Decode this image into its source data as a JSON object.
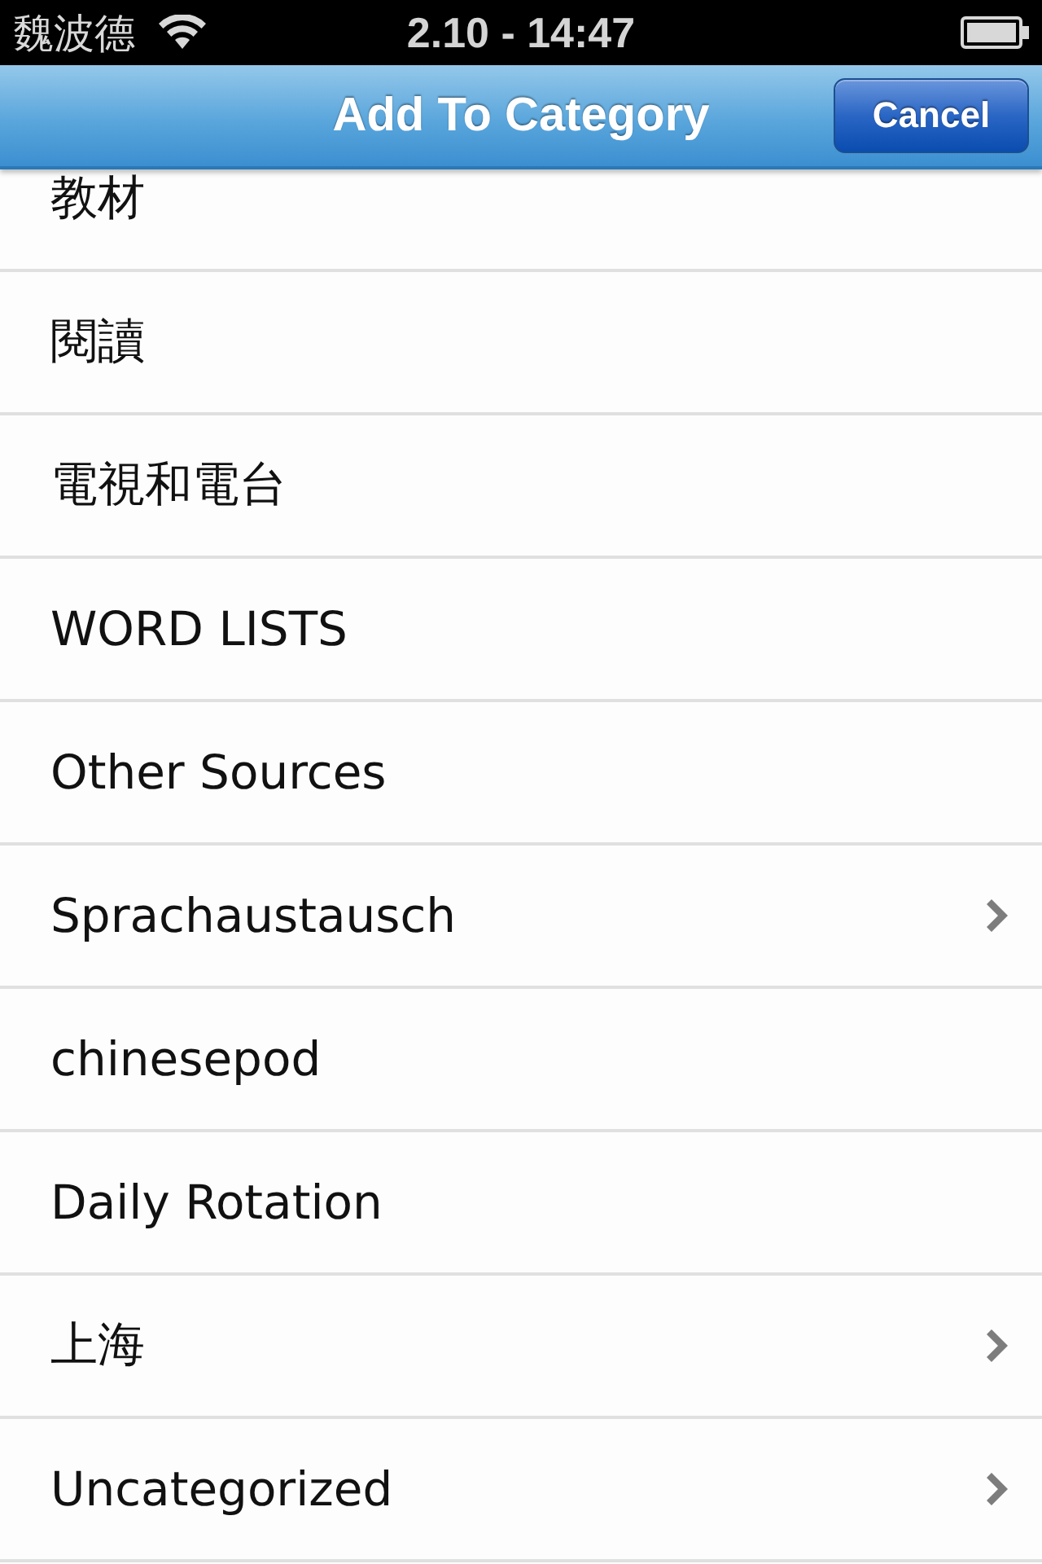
{
  "status_bar": {
    "carrier": "魏波德",
    "time": "2.10 - 14:47"
  },
  "nav_bar": {
    "title": "Add To Category",
    "cancel_button": "Cancel"
  },
  "categories": [
    {
      "label": "教材",
      "has_children": false
    },
    {
      "label": "閱讀",
      "has_children": false
    },
    {
      "label": "電視和電台",
      "has_children": false
    },
    {
      "label": "WORD LISTS",
      "has_children": false
    },
    {
      "label": "Other Sources",
      "has_children": false
    },
    {
      "label": "Sprachaustausch",
      "has_children": true
    },
    {
      "label": "chinesepod",
      "has_children": false
    },
    {
      "label": "Daily Rotation",
      "has_children": false
    },
    {
      "label": "上海",
      "has_children": true
    },
    {
      "label": "Uncategorized",
      "has_children": true
    }
  ]
}
